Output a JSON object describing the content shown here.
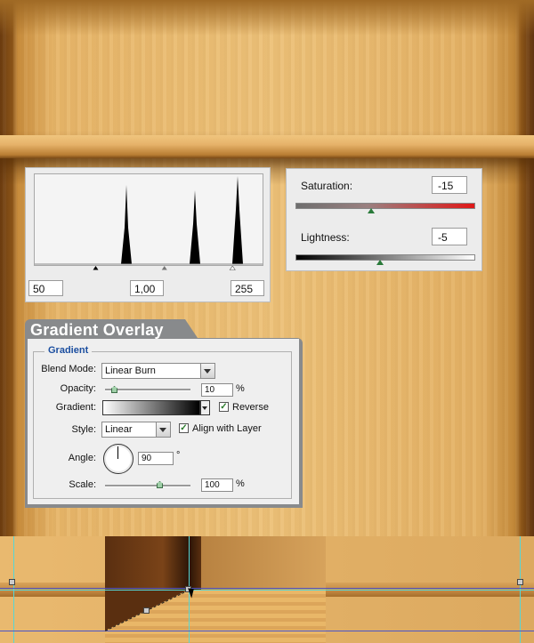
{
  "levels": {
    "input_black": "50",
    "input_gamma": "1,00",
    "input_white": "255"
  },
  "hue_saturation": {
    "saturation_label": "Saturation:",
    "saturation_value": "-15",
    "lightness_label": "Lightness:",
    "lightness_value": "-5",
    "saturation_bar_color": "#e01818"
  },
  "gradient_overlay": {
    "title": "Gradient Overlay",
    "group_label": "Gradient",
    "blend_mode_label": "Blend Mode:",
    "blend_mode_value": "Linear Burn",
    "opacity_label": "Opacity:",
    "opacity_value": "10",
    "opacity_unit": "%",
    "gradient_label": "Gradient:",
    "reverse_label": "Reverse",
    "reverse_checked": true,
    "style_label": "Style:",
    "style_value": "Linear",
    "align_label": "Align with Layer",
    "align_checked": true,
    "angle_label": "Angle:",
    "angle_value": "90",
    "angle_unit": "°",
    "scale_label": "Scale:",
    "scale_value": "100",
    "scale_unit": "%"
  },
  "icons": [
    "checkmark-icon",
    "dropdown-arrow-icon",
    "angle-dial-icon",
    "mouse-cursor-icon"
  ]
}
